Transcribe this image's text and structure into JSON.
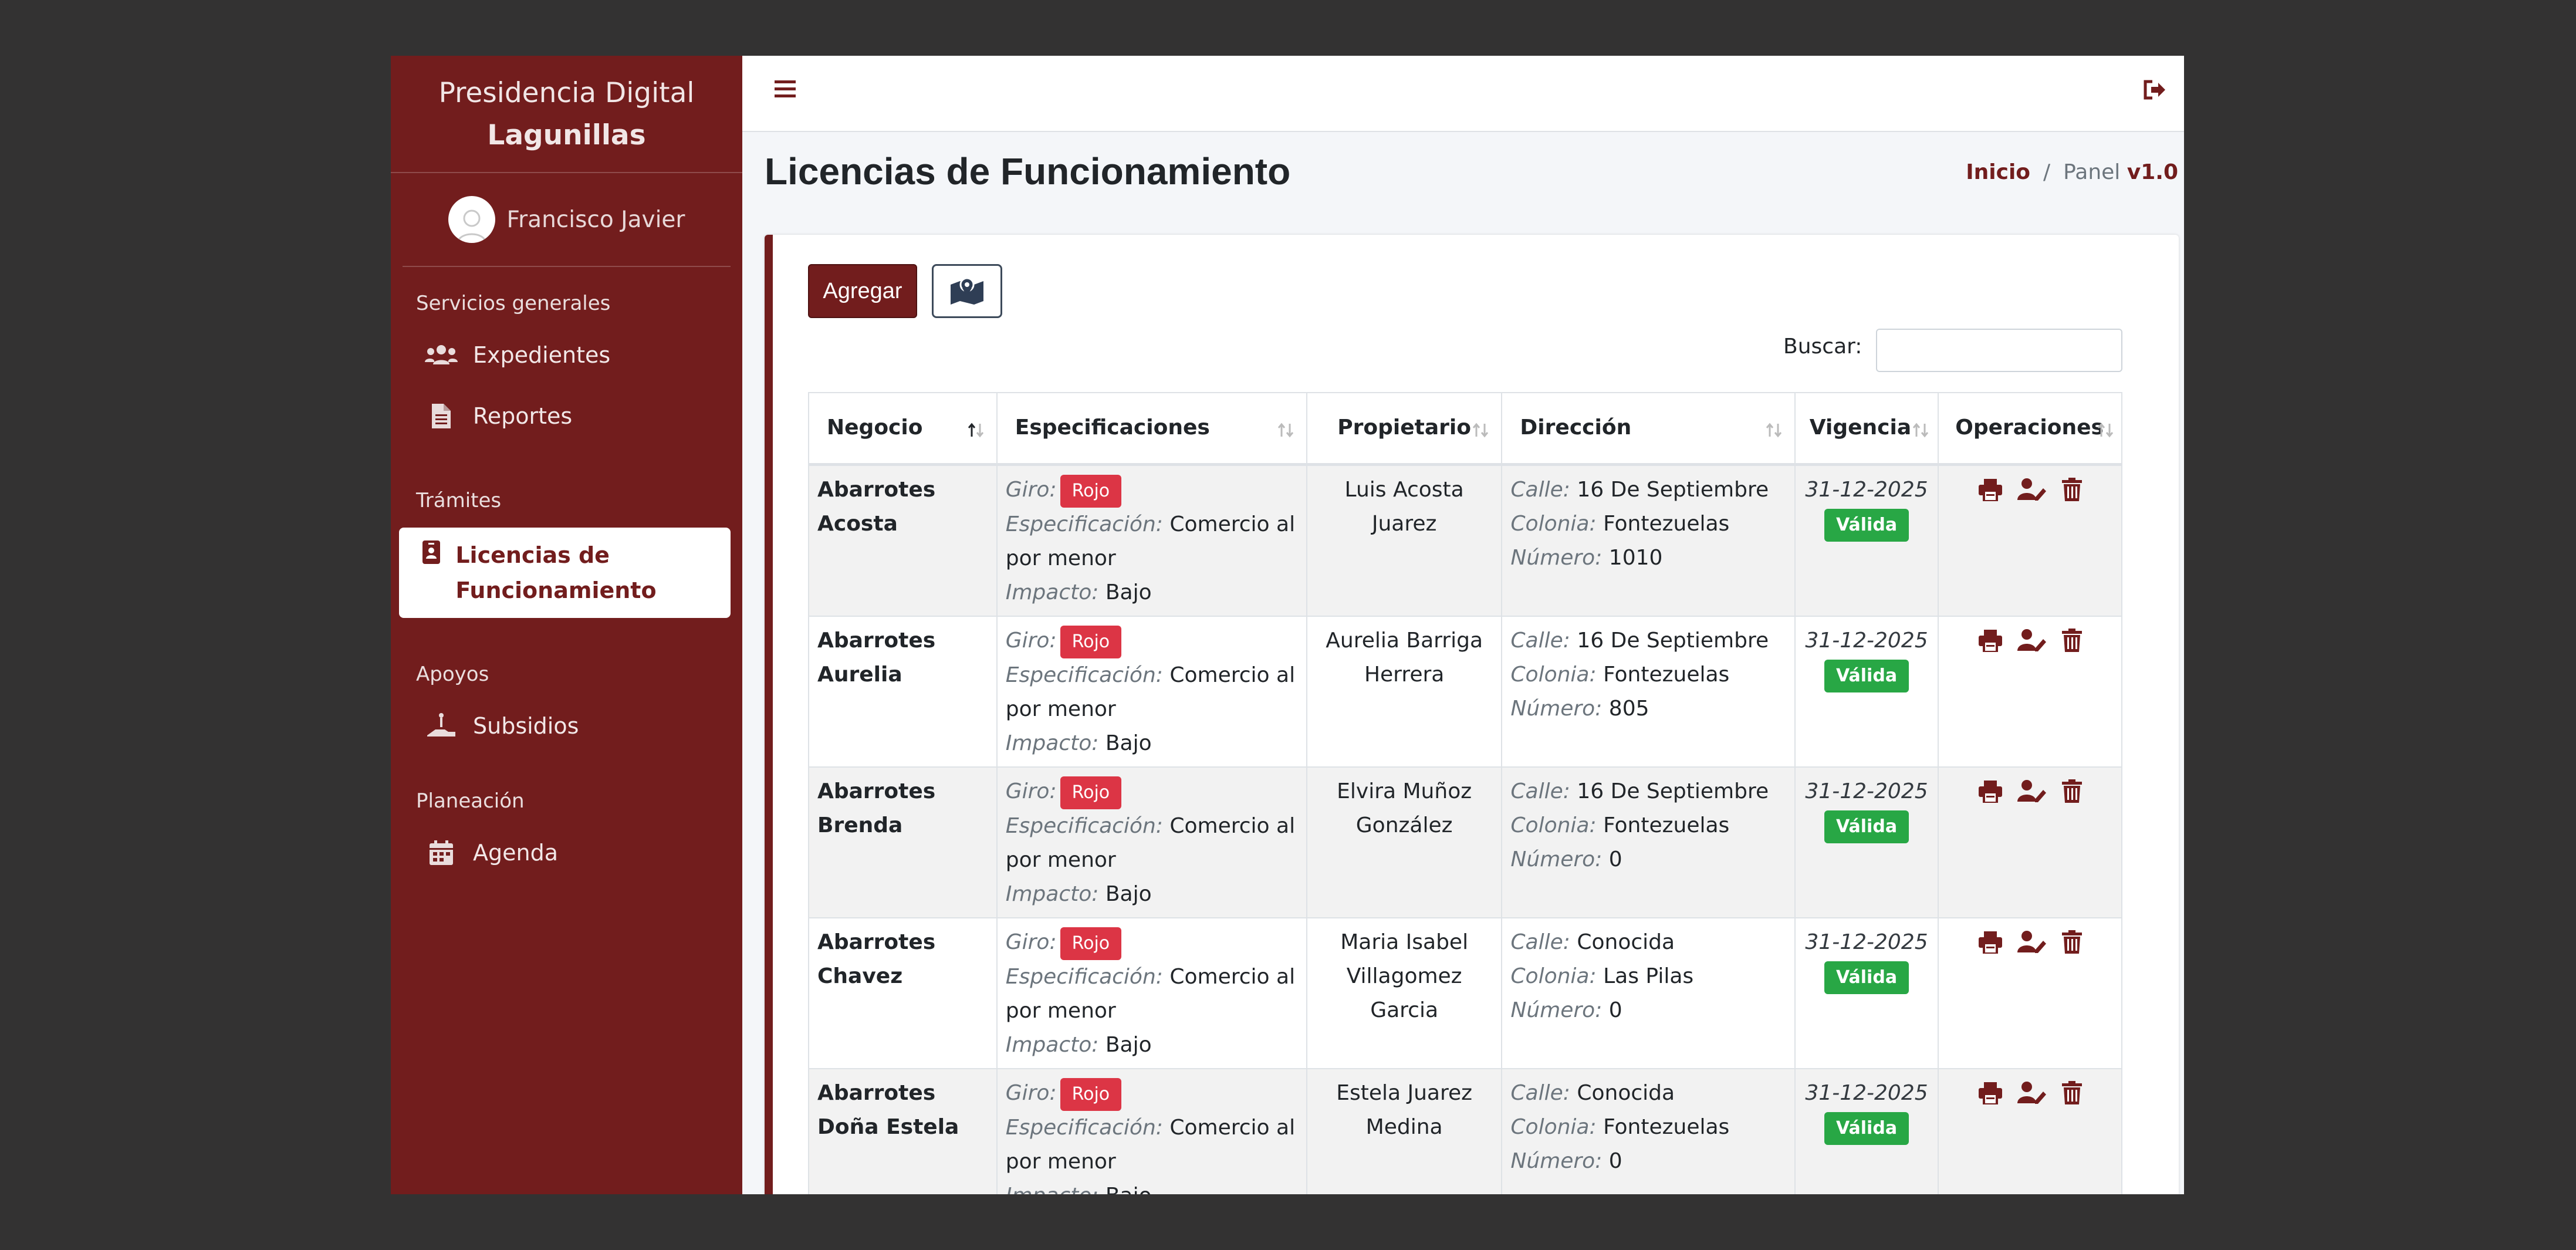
{
  "brand": {
    "line1": "Presidencia Digital",
    "line2": "Lagunillas"
  },
  "user": {
    "name": "Francisco Javier"
  },
  "sidebar": {
    "sections": [
      {
        "header": "Servicios generales",
        "items": [
          {
            "label": "Expedientes",
            "icon": "users-icon"
          },
          {
            "label": "Reportes",
            "icon": "document-icon"
          }
        ]
      },
      {
        "header": "Trámites",
        "items": [
          {
            "label": "Licencias de Funcionamiento",
            "icon": "id-badge-icon",
            "active": true
          }
        ]
      },
      {
        "header": "Apoyos",
        "items": [
          {
            "label": "Subsidios",
            "icon": "hand-coin-icon"
          }
        ]
      },
      {
        "header": "Planeación",
        "items": [
          {
            "label": "Agenda",
            "icon": "calendar-icon"
          }
        ]
      }
    ]
  },
  "header": {
    "title": "Licencias de Funcionamiento",
    "breadcrumb": {
      "home": "Inicio",
      "separator": "/",
      "current": "Panel",
      "version": "v1.0"
    }
  },
  "toolbar": {
    "add_label": "Agregar",
    "map_icon": "map-marker-icon"
  },
  "search": {
    "label": "Buscar:",
    "value": ""
  },
  "table": {
    "columns": [
      "Negocio",
      "Especificaciones",
      "Propietario",
      "Dirección",
      "Vigencia",
      "Operaciones"
    ],
    "labels": {
      "giro": "Giro:",
      "especificacion": "Especificación:",
      "impacto": "Impacto:",
      "calle": "Calle:",
      "colonia": "Colonia:",
      "numero": "Número:"
    },
    "rows": [
      {
        "negocio": "Abarrotes Acosta",
        "giro": "Rojo",
        "especificacion": "Comercio al por menor",
        "impacto": "Bajo",
        "propietario": "Luis Acosta Juarez",
        "calle": "16 De Septiembre",
        "colonia": "Fontezuelas",
        "numero": "1010",
        "vigencia": "31-12-2025",
        "estado": "Válida"
      },
      {
        "negocio": "Abarrotes Aurelia",
        "giro": "Rojo",
        "especificacion": "Comercio al por menor",
        "impacto": "Bajo",
        "propietario": "Aurelia Barriga Herrera",
        "calle": "16 De Septiembre",
        "colonia": "Fontezuelas",
        "numero": "805",
        "vigencia": "31-12-2025",
        "estado": "Válida"
      },
      {
        "negocio": "Abarrotes Brenda",
        "giro": "Rojo",
        "especificacion": "Comercio al por menor",
        "impacto": "Bajo",
        "propietario": "Elvira Muñoz González",
        "calle": "16 De Septiembre",
        "colonia": "Fontezuelas",
        "numero": "0",
        "vigencia": "31-12-2025",
        "estado": "Válida"
      },
      {
        "negocio": "Abarrotes Chavez",
        "giro": "Rojo",
        "especificacion": "Comercio al por menor",
        "impacto": "Bajo",
        "propietario": "Maria Isabel Villagomez Garcia",
        "calle": "Conocida",
        "colonia": "Las Pilas",
        "numero": "0",
        "vigencia": "31-12-2025",
        "estado": "Válida"
      },
      {
        "negocio": "Abarrotes Doña Estela",
        "giro": "Rojo",
        "especificacion": "Comercio al por menor",
        "impacto": "Bajo",
        "propietario": "Estela Juarez Medina",
        "calle": "Conocida",
        "colonia": "Fontezuelas",
        "numero": "0",
        "vigencia": "31-12-2025",
        "estado": "Válida"
      }
    ]
  },
  "colors": {
    "brand": "#721d1d",
    "danger": "#dc3545",
    "success": "#28a745"
  }
}
